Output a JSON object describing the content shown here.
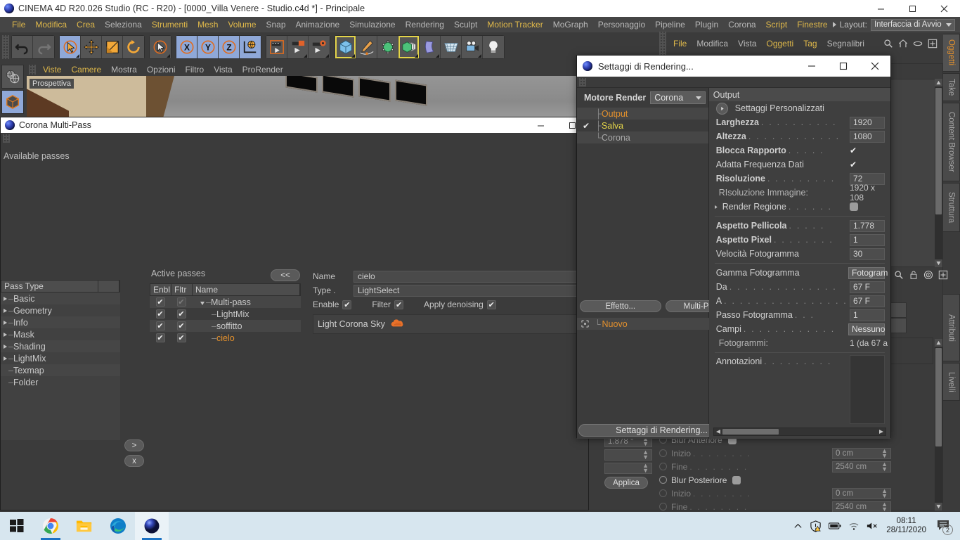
{
  "window": {
    "title": "CINEMA 4D R20.026 Studio (RC - R20) - [0000_Villa Venere - Studio.c4d *] - Principale",
    "minimize": "—",
    "maximize": "☐",
    "close": "✕"
  },
  "menubar": {
    "items": [
      {
        "label": "File",
        "highlight": true
      },
      {
        "label": "Modifica",
        "highlight": true
      },
      {
        "label": "Crea",
        "highlight": true
      },
      {
        "label": "Seleziona",
        "highlight": false
      },
      {
        "label": "Strumenti",
        "highlight": true
      },
      {
        "label": "Mesh",
        "highlight": true
      },
      {
        "label": "Volume",
        "highlight": true
      },
      {
        "label": "Snap",
        "highlight": false
      },
      {
        "label": "Animazione",
        "highlight": false
      },
      {
        "label": "Simulazione",
        "highlight": false
      },
      {
        "label": "Rendering",
        "highlight": false
      },
      {
        "label": "Sculpt",
        "highlight": false
      },
      {
        "label": "Motion Tracker",
        "highlight": true
      },
      {
        "label": "MoGraph",
        "highlight": false
      },
      {
        "label": "Personaggio",
        "highlight": false
      },
      {
        "label": "Pipeline",
        "highlight": false
      },
      {
        "label": "Plugin",
        "highlight": false
      },
      {
        "label": "Corona",
        "highlight": false
      },
      {
        "label": "Script",
        "highlight": true
      },
      {
        "label": "Finestre",
        "highlight": true
      }
    ],
    "layout_label": "Layout:",
    "layout_value": "Interfaccia di Avvio"
  },
  "object_manager_menu": {
    "items": [
      {
        "label": "File",
        "highlight": true
      },
      {
        "label": "Modifica",
        "highlight": false
      },
      {
        "label": "Vista",
        "highlight": false
      },
      {
        "label": "Oggetti",
        "highlight": true
      },
      {
        "label": "Tag",
        "highlight": true
      },
      {
        "label": "Segnalibri",
        "highlight": false
      }
    ]
  },
  "right_tabs": [
    {
      "label": "Oggetti",
      "active": true
    },
    {
      "label": "Take",
      "active": false
    },
    {
      "label": "Content Browser",
      "active": false
    },
    {
      "label": "Struttura",
      "active": false
    },
    {
      "label": "Attributi",
      "active": true
    },
    {
      "label": "Livelli",
      "active": false
    }
  ],
  "viewport": {
    "menu": [
      "Viste",
      "Camere",
      "Mostra",
      "Opzioni",
      "Filtro",
      "Vista",
      "ProRender"
    ],
    "label": "Prospettiva"
  },
  "multipass": {
    "title": "Corona Multi-Pass",
    "available_label": "Available passes",
    "available_col": "Pass Type",
    "available_items": [
      {
        "label": "Basic",
        "expandable": true
      },
      {
        "label": "Geometry",
        "expandable": true
      },
      {
        "label": "Info",
        "expandable": true
      },
      {
        "label": "Mask",
        "expandable": true
      },
      {
        "label": "Shading",
        "expandable": true
      },
      {
        "label": "LightMix",
        "expandable": true
      },
      {
        "label": "Texmap",
        "expandable": false
      },
      {
        "label": "Folder",
        "expandable": false
      }
    ],
    "add_btn": ">",
    "remove_btn": "x",
    "active_label": "Active passes",
    "collapse_btn": "<<",
    "active_cols": [
      "Enbl",
      "Fltr",
      "Name"
    ],
    "active_rows": [
      {
        "enbl": true,
        "fltr": true,
        "name": "Multi-pass",
        "depth": 0,
        "selected": false,
        "dimmed_fltr": true
      },
      {
        "enbl": true,
        "fltr": true,
        "name": "LightMix",
        "depth": 1,
        "selected": false,
        "dimmed_fltr": false
      },
      {
        "enbl": true,
        "fltr": true,
        "name": "soffitto",
        "depth": 1,
        "selected": false,
        "dimmed_fltr": false
      },
      {
        "enbl": true,
        "fltr": true,
        "name": "cielo",
        "depth": 1,
        "selected": true,
        "dimmed_fltr": false
      }
    ],
    "detail": {
      "name_label": "Name",
      "name_value": "cielo",
      "type_label": "Type .",
      "type_value": "LightSelect",
      "enable_label": "Enable",
      "filter_label": "Filter",
      "denoise_label": "Apply denoising",
      "light_entry": "Light Corona Sky"
    }
  },
  "render_settings": {
    "title": "Settaggi di Rendering...",
    "engine_label": "Motore Render",
    "engine_value": "Corona",
    "tree": [
      {
        "label": "Output",
        "selected": true,
        "checked": false
      },
      {
        "label": "Salva",
        "selected": false,
        "checked": true,
        "yellow": true
      },
      {
        "label": "Corona",
        "selected": false,
        "checked": false
      }
    ],
    "effect_btn": "Effetto...",
    "multipass_btn": "Multi-Pass...",
    "new_item": "Nuovo",
    "bottom_btn": "Settaggi di Rendering...",
    "panel_title": "Output",
    "props": [
      {
        "label": "Settaggi Personalizzati",
        "type": "arrowlabel",
        "value": ""
      },
      {
        "label": "Larghezza",
        "type": "field",
        "value": "1920",
        "bold": true
      },
      {
        "label": "Altezza",
        "type": "field",
        "value": "1080",
        "bold": true
      },
      {
        "label": "Blocca Rapporto",
        "type": "check",
        "value": "✔",
        "bold": true
      },
      {
        "label": "Adatta Frequenza Dati",
        "type": "check",
        "value": "✔",
        "bold": false
      },
      {
        "label": "Risoluzione",
        "type": "field",
        "value": "72",
        "bold": true
      },
      {
        "label": "RIsoluzione Immagine:",
        "type": "static",
        "value": "1920 x 108",
        "bold": false
      },
      {
        "label": "Render Regione",
        "type": "toggle",
        "value": "",
        "bold": false,
        "arrow": true
      }
    ],
    "props2": [
      {
        "label": "Aspetto Pellicola",
        "type": "field",
        "value": "1.778",
        "bold": true
      },
      {
        "label": "Aspetto Pixel",
        "type": "field",
        "value": "1",
        "bold": true
      },
      {
        "label": "Velocità Fotogramma",
        "type": "field",
        "value": "30",
        "bold": false
      }
    ],
    "props3": [
      {
        "label": "Gamma Fotogramma",
        "type": "button",
        "value": "Fotogram",
        "bold": false
      },
      {
        "label": "Da",
        "type": "field",
        "value": "67 F",
        "bold": false
      },
      {
        "label": "A",
        "type": "field",
        "value": "67 F",
        "bold": false
      },
      {
        "label": "Passo Fotogramma",
        "type": "field",
        "value": "1",
        "bold": false
      },
      {
        "label": "Campi",
        "type": "button",
        "value": "Nessuno",
        "bold": false
      }
    ],
    "frames_label": "Fotogrammi:",
    "frames_value": "1 (da 67 a",
    "annotations_label": "Annotazioni"
  },
  "attributes_panel": {
    "angle_value": "1.878 °",
    "apply_btn": "Applica",
    "rows": [
      {
        "label": "Blur Anteriore",
        "type": "toggle",
        "dim": true,
        "radio": true
      },
      {
        "label": "Inizio",
        "type": "field",
        "value": "0 cm",
        "dim": true,
        "radio": true
      },
      {
        "label": "Fine",
        "type": "field",
        "value": "2540 cm",
        "dim": true,
        "radio": true
      },
      {
        "label": "Blur Posteriore",
        "type": "toggle",
        "dim": false,
        "radio": true
      },
      {
        "label": "Inizio",
        "type": "field",
        "value": "0 cm",
        "dim": true,
        "radio": true
      },
      {
        "label": "Fine",
        "type": "field",
        "value": "2540 cm",
        "dim": true,
        "radio": true
      }
    ]
  },
  "taskbar": {
    "items": [
      "start-icon",
      "chrome-icon",
      "explorer-icon",
      "edge-icon",
      "cinema4d-icon"
    ],
    "time": "08:11",
    "date": "28/11/2020",
    "notification_count": "2"
  }
}
